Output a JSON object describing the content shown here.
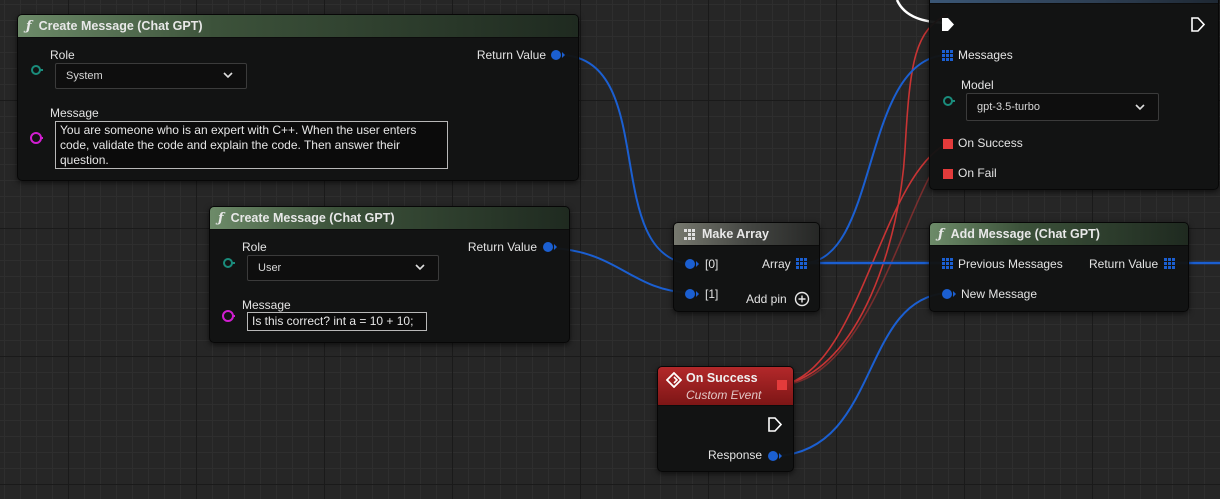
{
  "nodes": {
    "create_msg_1": {
      "title": "Create Message (Chat GPT)",
      "role_label": "Role",
      "role_value": "System",
      "message_label": "Message",
      "message_value": "You are someone who is an expert with C++. When the user enters code, validate the code and explain the code. Then answer their question.",
      "return_label": "Return Value"
    },
    "create_msg_2": {
      "title": "Create Message (Chat GPT)",
      "role_label": "Role",
      "role_value": "User",
      "message_label": "Message",
      "message_value": "Is this correct? int a = 10 + 10;",
      "return_label": "Return Value"
    },
    "make_array": {
      "title": "Make Array",
      "in0": "[0]",
      "in1": "[1]",
      "out": "Array",
      "add_pin": "Add pin"
    },
    "chat_request": {
      "messages_label": "Messages",
      "model_label": "Model",
      "model_value": "gpt-3.5-turbo",
      "on_success": "On Success",
      "on_fail": "On Fail"
    },
    "add_message": {
      "title": "Add Message (Chat GPT)",
      "prev_label": "Previous Messages",
      "new_label": "New Message",
      "return_label": "Return Value"
    },
    "on_success_event": {
      "title": "On Success",
      "subtitle": "Custom Event",
      "response_label": "Response"
    }
  },
  "colors": {
    "struct_pin": "#1b5fd1",
    "delegate_red": "#e33b3b",
    "enum_pin": "#1a8c7c",
    "string_pin": "#d11ed1",
    "exec": "#ffffff"
  }
}
